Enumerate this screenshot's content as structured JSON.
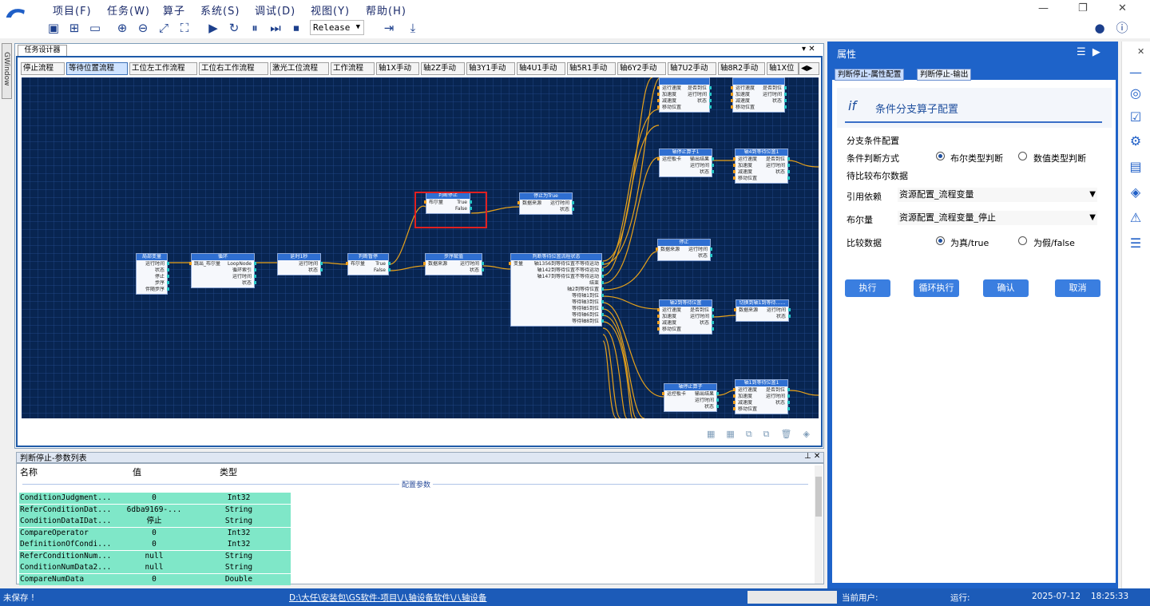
{
  "menus": [
    "项目(F)",
    "任务(W)",
    "算子",
    "系统(S)",
    "调试(D)",
    "视图(Y)",
    "帮助(H)"
  ],
  "toolbar": {
    "release": "Release"
  },
  "left_dock": {
    "label": "GWindow"
  },
  "designer": {
    "tab": "任务设计器",
    "flow_tabs": [
      "停止流程",
      "等待位置流程",
      "工位左工作流程",
      "工位右工作流程",
      "激光工位流程",
      "工作流程",
      "轴1X手动",
      "轴2Z手动",
      "轴3Y1手动",
      "轴4U1手动",
      "轴5R1手动",
      "轴6Y2手动",
      "轴7U2手动",
      "轴8R2手动",
      "轴1X位"
    ],
    "active_tab": 1
  },
  "nodes": [
    {
      "title": "局部变量",
      "rows": [
        [
          "",
          "运行时间"
        ],
        [
          "",
          "状态"
        ],
        [
          "",
          "停止"
        ],
        [
          "",
          "步序"
        ],
        [
          "",
          "伴随步序"
        ]
      ]
    },
    {
      "title": "循环",
      "rows": [
        [
          "跳出_布尔量",
          "LoopNode"
        ],
        [
          "",
          "循环索引"
        ],
        [
          "",
          "运行时间"
        ],
        [
          "",
          "状态"
        ]
      ]
    },
    {
      "title": "延时1秒",
      "rows": [
        [
          "",
          "运行时间"
        ],
        [
          "",
          "状态"
        ]
      ]
    },
    {
      "title": "判断暂停",
      "rows": [
        [
          "布尔量",
          "True"
        ],
        [
          "",
          "False"
        ]
      ]
    },
    {
      "title": "判断停止",
      "rows": [
        [
          "布尔量",
          "True"
        ],
        [
          "",
          "False"
        ]
      ]
    },
    {
      "title": "停止为True",
      "rows": [
        [
          "数据来源",
          "运行时间"
        ],
        [
          "",
          "状态"
        ]
      ]
    },
    {
      "title": "步序赋值",
      "rows": [
        [
          "数据来源",
          "运行时间"
        ],
        [
          "",
          "状态"
        ]
      ]
    },
    {
      "title": "判断等待位置流程状态",
      "rows": [
        [
          "变量",
          "轴1356到等待位置不等待运动"
        ],
        [
          "",
          "轴142到等待位置不等待运动"
        ],
        [
          "",
          "轴147到等待位置不等待运动"
        ],
        [
          "",
          "结束"
        ],
        [
          "",
          "轴2到等待位置"
        ],
        [
          "",
          "等待轴1到位"
        ],
        [
          "",
          "等待轴3到位"
        ],
        [
          "",
          "等待轴5到位"
        ],
        [
          "",
          "等待轴6到位"
        ],
        [
          "",
          "等待轴8到位"
        ]
      ]
    },
    {
      "title": "",
      "rows": [
        [
          "运行速度",
          "是否到位"
        ],
        [
          "加速度",
          "运行时间"
        ],
        [
          "减速度",
          "状态"
        ],
        [
          "移动位置",
          ""
        ]
      ]
    },
    {
      "title": "",
      "rows": [
        [
          "运行速度",
          "是否到位"
        ],
        [
          "加速度",
          "运行时间"
        ],
        [
          "减速度",
          "状态"
        ],
        [
          "移动位置",
          ""
        ]
      ]
    },
    {
      "title": "轴停止算子1",
      "rows": [
        [
          "运控板卡",
          "输出结果"
        ],
        [
          "",
          "运行时间"
        ],
        [
          "",
          "状态"
        ]
      ]
    },
    {
      "title": "轴4到等待位置1",
      "rows": [
        [
          "运行速度",
          "是否到位"
        ],
        [
          "加速度",
          "运行时间"
        ],
        [
          "减速度",
          "状态"
        ],
        [
          "移动位置",
          ""
        ]
      ]
    },
    {
      "title": "停止",
      "rows": [
        [
          "数据来源",
          "运行时间"
        ],
        [
          "",
          "状态"
        ]
      ]
    },
    {
      "title": "轴2到等待位置",
      "rows": [
        [
          "运行速度",
          "是否到位"
        ],
        [
          "加速度",
          "运行时间"
        ],
        [
          "减速度",
          "状态"
        ],
        [
          "移动位置",
          ""
        ]
      ]
    },
    {
      "title": "切换到轴1到等待……",
      "rows": [
        [
          "数据来源",
          "运行时间"
        ],
        [
          "",
          "状态"
        ]
      ]
    },
    {
      "title": "轴停止算子",
      "rows": [
        [
          "运控板卡",
          "输出结果"
        ],
        [
          "",
          "运行时间"
        ],
        [
          "",
          "状态"
        ]
      ]
    },
    {
      "title": "轴1到等待位置1",
      "rows": [
        [
          "运行速度",
          "是否到位"
        ],
        [
          "加速度",
          "运行时间"
        ],
        [
          "减速度",
          "状态"
        ],
        [
          "移动位置",
          ""
        ]
      ]
    }
  ],
  "param_list": {
    "title": "判断停止-参数列表",
    "headers": [
      "名称",
      "值",
      "类型"
    ],
    "section": "配置参数",
    "rows": [
      [
        "ConditionJudgment...",
        "0",
        "Int32"
      ],
      [
        "ReferConditionDat...",
        "6dba9169-...",
        "String"
      ],
      [
        "ConditionDataIDat...",
        "停止",
        "String"
      ],
      [
        "CompareOperator",
        "0",
        "Int32"
      ],
      [
        "DefinitionOfCondi...",
        "0",
        "Int32"
      ],
      [
        "ReferConditionNum...",
        "null",
        "String"
      ],
      [
        "ConditionNumData2...",
        "null",
        "String"
      ],
      [
        "CompareNumData",
        "0",
        "Double"
      ]
    ]
  },
  "properties": {
    "title": "属性",
    "tabs": [
      "判断停止-属性配置",
      "判断停止-输出"
    ],
    "config_title": "条件分支算子配置",
    "section1": "分支条件配置",
    "judge_label": "条件判断方式",
    "judge_opt1": "布尔类型判断",
    "judge_opt2": "数值类型判断",
    "section2": "待比较布尔数据",
    "ref_label": "引用依赖",
    "ref_value": "资源配置_流程变量",
    "bool_label": "布尔量",
    "bool_value": "资源配置_流程变量_停止",
    "compare_label": "比较数据",
    "compare_opt1": "为真/true",
    "compare_opt2": "为假/false",
    "buttons": [
      "执行",
      "循环执行",
      "确认",
      "取消"
    ]
  },
  "status": {
    "save": "未保存 !",
    "path": "D:\\大任\\安装包\\GS软件-项目\\八轴设备软件\\八轴设备",
    "user": "当前用户:",
    "run": "运行:",
    "date": "2025-07-12",
    "time": "18:25:33"
  },
  "colors": {
    "canvas_bg": "#082551",
    "wire": "#e8a21a",
    "node_header": "#2f6fd1",
    "accent": "#1e63c9",
    "selection": "#e02020"
  }
}
